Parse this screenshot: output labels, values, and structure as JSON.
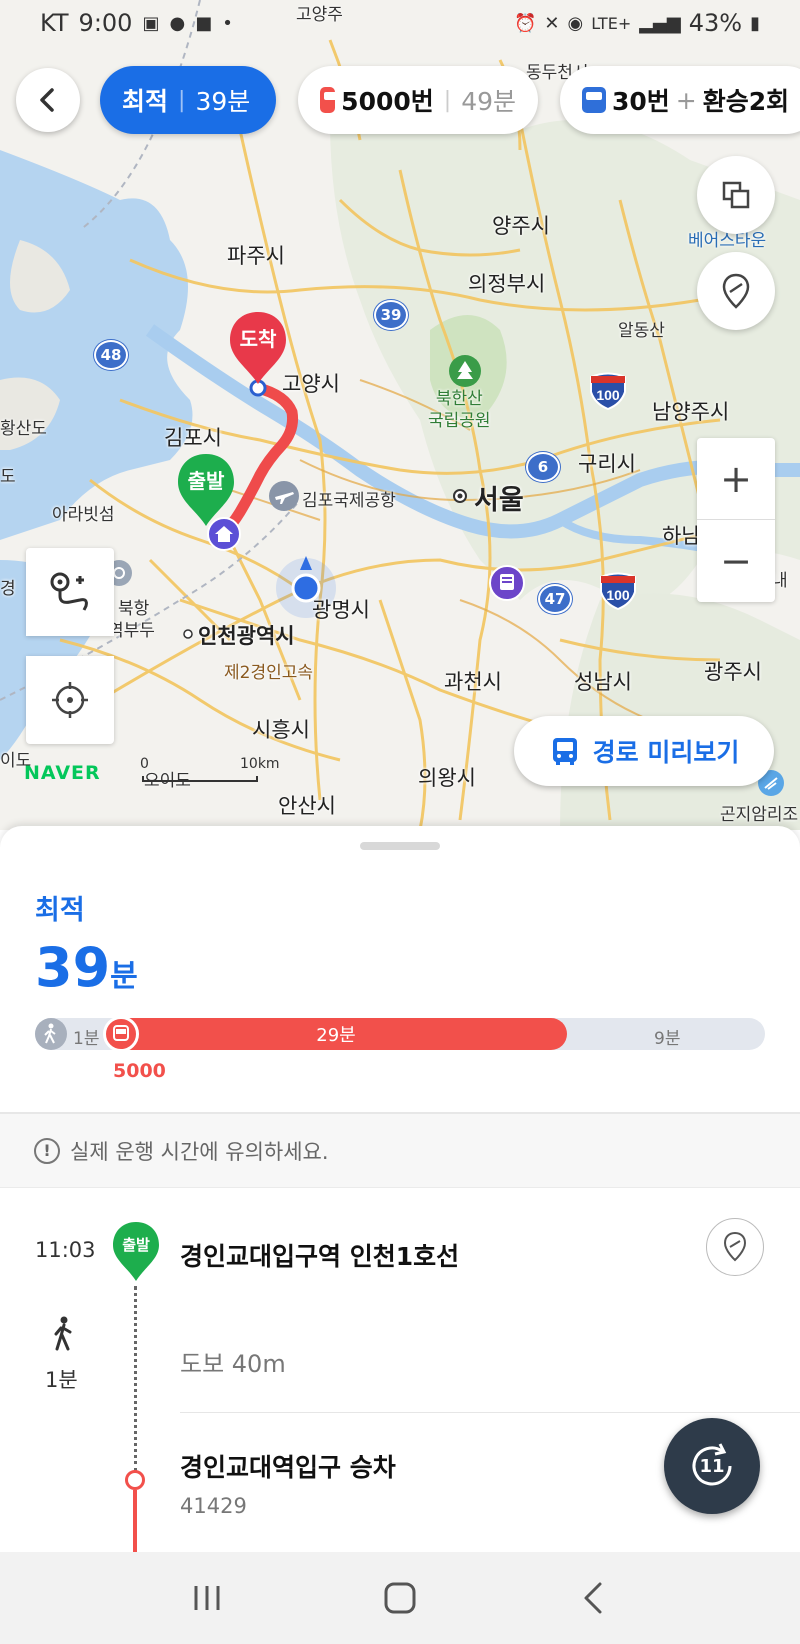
{
  "status_bar": {
    "carrier": "KT",
    "time": "9:00",
    "network": "LTE+",
    "battery": "43%"
  },
  "route_tabs": [
    {
      "label": "최적",
      "minutes": "39분",
      "active": true
    },
    {
      "label": "5000번",
      "minutes": "49분",
      "mode": "bus",
      "color": "#f2504b"
    },
    {
      "label": "30번",
      "plus": "+",
      "extra": "환승2회",
      "mode": "bus",
      "color": "#2f6fd9"
    }
  ],
  "map": {
    "labels": {
      "paju": "파주시",
      "yangju": "양주시",
      "uijeongbu": "의정부시",
      "goyang": "고양시",
      "gimpo": "김포시",
      "bukhansan": "북한산",
      "national_park": "국립공원",
      "gimpo_airport": "김포국제공항",
      "seoul": "서울",
      "guri": "구리시",
      "namyangju": "남양주시",
      "ara": "아라빗섬",
      "incheon": "인천광역시",
      "gwangmyeong": "광명시",
      "gwacheon": "과천시",
      "seongnam": "성남시",
      "gwangju": "광주시",
      "siheung": "시흥시",
      "uiwang": "의왕시",
      "ansan": "안산시",
      "hanam": "하남",
      "aldong": "알동산",
      "expressway": "제2경인고속",
      "bukhang": "북항",
      "budu": "역부두",
      "oido": "오이도",
      "beoleo": "베어스타운",
      "gonjiam": "곤지암리조",
      "hwangsando": "황산도",
      "do": "도",
      "dongducheon": "동두천시",
      "goyangju": "고양주",
      "nae": "내",
      "cheon": "경",
      "ido": "이도"
    },
    "shields": {
      "s39": "39",
      "s48": "48",
      "s6": "6",
      "s47": "47",
      "i100a": "100",
      "i100b": "100"
    },
    "pins": {
      "arrive": "도착",
      "depart": "출발"
    },
    "brand": "NAVER",
    "scale": {
      "zero": "0",
      "dist": "10km"
    },
    "preview_button": "경로 미리보기",
    "route_color": "#ef4b4b"
  },
  "summary": {
    "option": "최적",
    "total_minutes": "39",
    "unit": "분",
    "walk_minutes": "1분",
    "bus_minutes": "29분",
    "last_minutes": "9분",
    "bus_number": "5000",
    "bus_fraction": 0.7
  },
  "notice": "실제 운행 시간에 유의하세요.",
  "steps": {
    "depart_time": "11:03",
    "depart_badge": "출발",
    "depart_stop": "경인교대입구역 인천1호선",
    "walk_duration": "1분",
    "walk_distance": "도보 40m",
    "board_stop": "경인교대역입구 승차",
    "board_stop_id": "41429",
    "refresh_count": "11"
  }
}
